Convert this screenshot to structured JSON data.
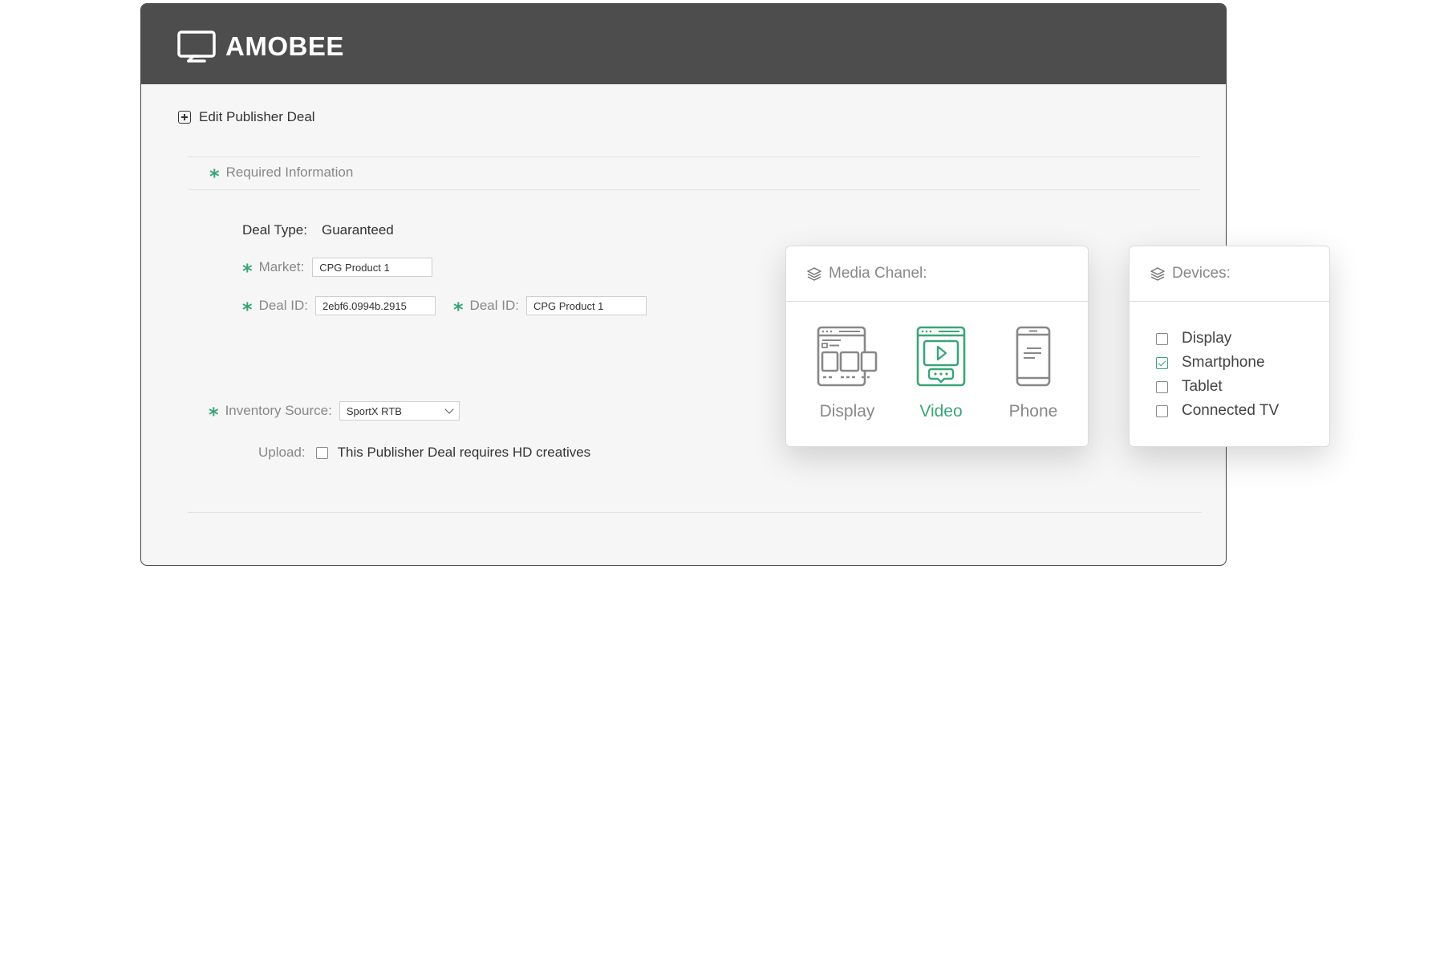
{
  "header": {
    "brand": "AMOBEE"
  },
  "page": {
    "title": "Edit Publisher Deal"
  },
  "section": {
    "title": "Required Information"
  },
  "form": {
    "deal_type": {
      "label": "Deal Type:",
      "value": "Guaranteed"
    },
    "market": {
      "label": "Market:",
      "value": "CPG Product 1"
    },
    "deal_id_1": {
      "label": "Deal ID:",
      "value": "2ebf6.0994b.2915"
    },
    "deal_id_2": {
      "label": "Deal ID:",
      "value": "CPG Product 1"
    },
    "inventory_source": {
      "label": "Inventory Source:",
      "value": "SportX RTB"
    },
    "upload": {
      "label": "Upload:",
      "checkbox_label": "This Publisher Deal requires HD creatives",
      "checked": false
    }
  },
  "media_channel": {
    "title": "Media Chanel:",
    "options": [
      {
        "label": "Display",
        "selected": false,
        "icon": "display-icon"
      },
      {
        "label": "Video",
        "selected": true,
        "icon": "video-icon"
      },
      {
        "label": "Phone",
        "selected": false,
        "icon": "phone-icon"
      }
    ]
  },
  "devices": {
    "title": "Devices:",
    "items": [
      {
        "label": "Display",
        "checked": false
      },
      {
        "label": "Smartphone",
        "checked": true
      },
      {
        "label": "Tablet",
        "checked": false
      },
      {
        "label": "Connected TV",
        "checked": false
      }
    ]
  },
  "colors": {
    "accent": "#3aa577",
    "header_bg": "#4d4d4d",
    "panel_bg": "#f6f6f6",
    "muted_text": "#888888"
  }
}
